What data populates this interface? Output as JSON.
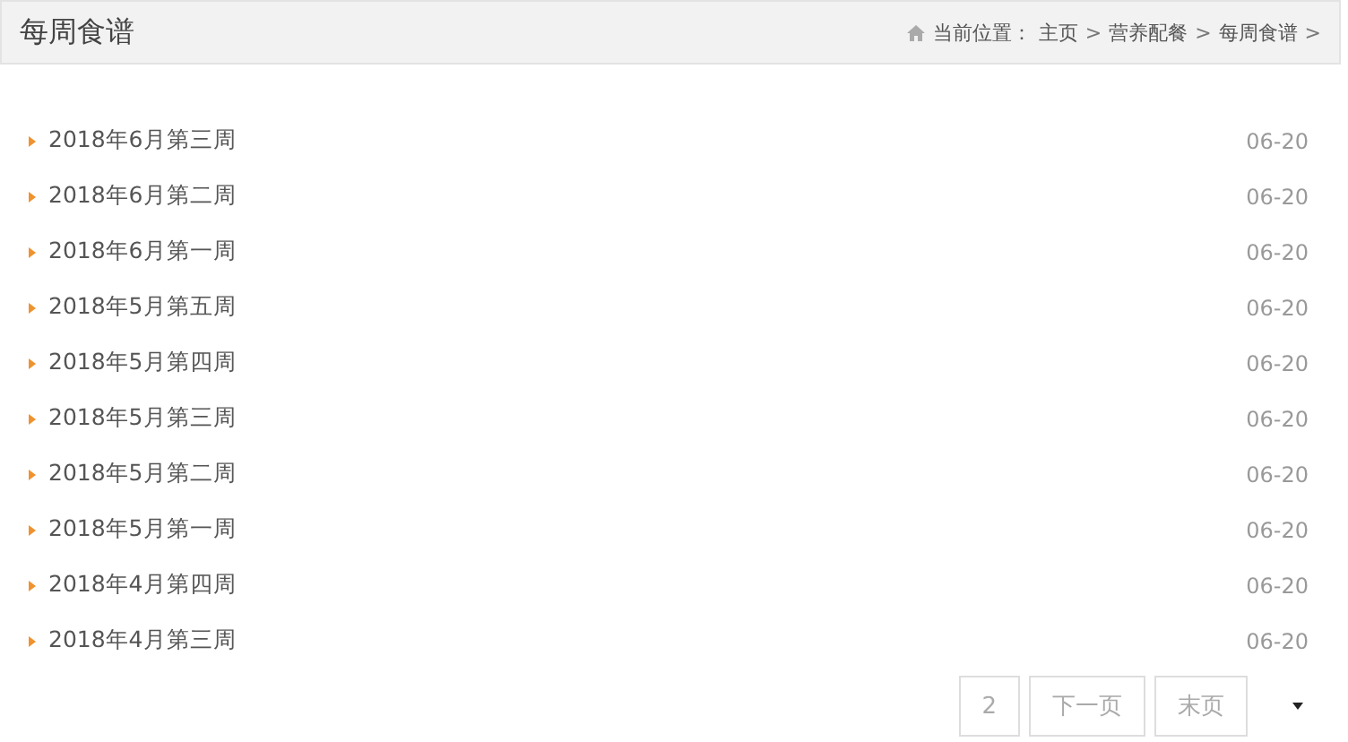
{
  "header": {
    "title": "每周食谱",
    "breadcrumb_label": "当前位置：",
    "breadcrumb": [
      "主页",
      "营养配餐",
      "每周食谱"
    ],
    "separator": ">"
  },
  "items": [
    {
      "title": "2018年6月第三周",
      "date": "06-20"
    },
    {
      "title": "2018年6月第二周",
      "date": "06-20"
    },
    {
      "title": "2018年6月第一周",
      "date": "06-20"
    },
    {
      "title": "2018年5月第五周",
      "date": "06-20"
    },
    {
      "title": "2018年5月第四周",
      "date": "06-20"
    },
    {
      "title": "2018年5月第三周",
      "date": "06-20"
    },
    {
      "title": "2018年5月第二周",
      "date": "06-20"
    },
    {
      "title": "2018年5月第一周",
      "date": "06-20"
    },
    {
      "title": "2018年4月第四周",
      "date": "06-20"
    },
    {
      "title": "2018年4月第三周",
      "date": "06-20"
    }
  ],
  "pagination": [
    "2",
    "下一页",
    "末页"
  ]
}
